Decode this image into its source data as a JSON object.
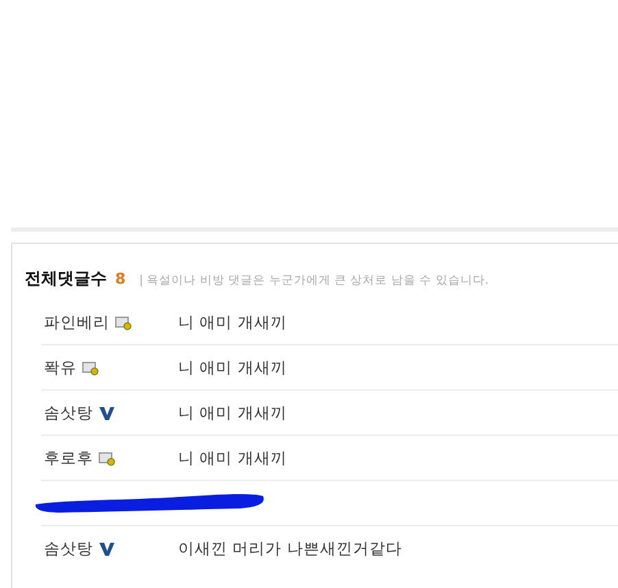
{
  "comments_header": {
    "title": "전체댓글수",
    "count": "8",
    "notice": "| 욕설이나 비방 댓글은 누군가에게 큰 상처로 남을 수 있습니다."
  },
  "comments": [
    {
      "kind": "normal",
      "author": "파인베리",
      "badge": {
        "kind": "member"
      },
      "text": "니 애미 개새끼"
    },
    {
      "kind": "normal",
      "author": "퐉유",
      "badge": {
        "kind": "member"
      },
      "text": "니 애미 개새끼"
    },
    {
      "kind": "normal",
      "author": "솜삿탕",
      "badge": {
        "kind": "verified"
      },
      "text": "니 애미 개새끼"
    },
    {
      "kind": "normal",
      "author": "후로후",
      "badge": {
        "kind": "member"
      },
      "text": "니 애미 개새끼"
    },
    {
      "kind": "redacted"
    },
    {
      "kind": "normal",
      "author": "솜삿탕",
      "badge": {
        "kind": "verified"
      },
      "text": "이새낀 머리가 나쁜새낀거같다"
    }
  ]
}
